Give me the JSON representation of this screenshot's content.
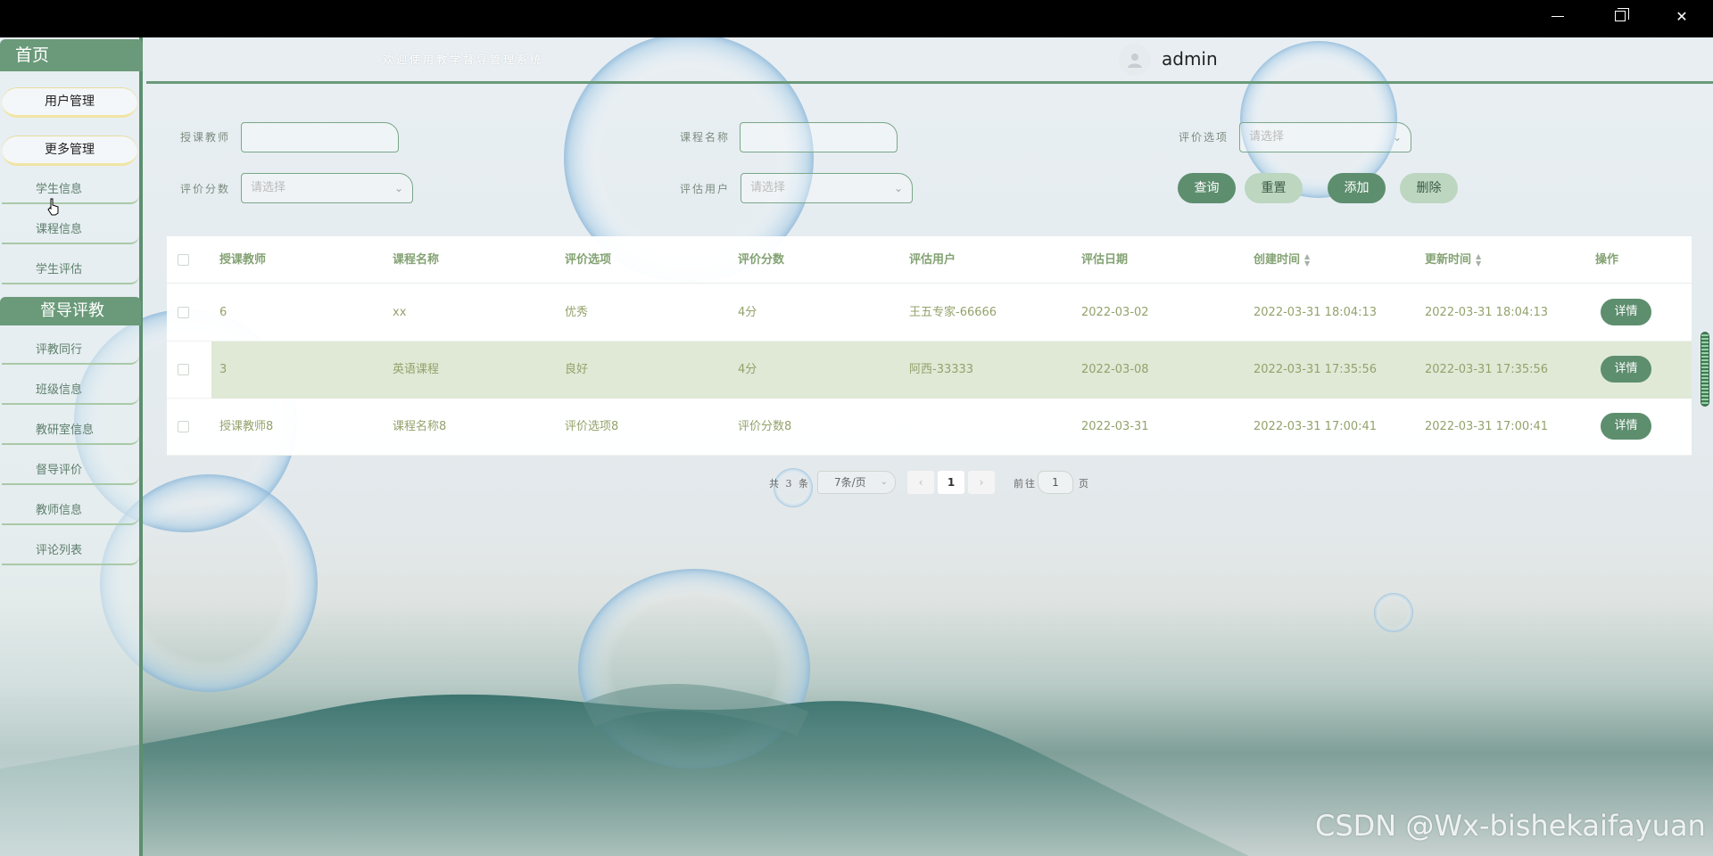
{
  "window_controls": {
    "minimize": "—",
    "maximize": "❐",
    "close": "✕"
  },
  "header": {
    "welcome": "欢迎使用教学督导管理系统",
    "username": "admin"
  },
  "sidebar": {
    "home": "首页",
    "pills": [
      "用户管理",
      "更多管理"
    ],
    "group1": [
      "学生信息",
      "课程信息",
      "学生评估"
    ],
    "section": "督导评教",
    "group2": [
      "评教同行",
      "班级信息",
      "教研室信息",
      "督导评价",
      "教师信息",
      "评论列表"
    ]
  },
  "search": {
    "teacher_label": "授课教师",
    "teacher_value": "",
    "course_label": "课程名称",
    "course_value": "",
    "option_label": "评价选项",
    "option_placeholder": "请选择",
    "score_label": "评价分数",
    "score_placeholder": "请选择",
    "user_label": "评估用户",
    "user_placeholder": "请选择",
    "query_btn": "查询",
    "reset_btn": "重置",
    "add_btn": "添加",
    "delete_btn": "删除"
  },
  "table": {
    "columns": [
      "授课教师",
      "课程名称",
      "评价选项",
      "评价分数",
      "评估用户",
      "评估日期",
      "创建时间",
      "更新时间",
      "操作"
    ],
    "rows": [
      {
        "teacher": "6",
        "course": "xx",
        "option": "优秀",
        "score": "4分",
        "user": "王五专家-66666",
        "date": "2022-03-02",
        "created": "2022-03-31 18:04:13",
        "updated": "2022-03-31 18:04:13",
        "action": "详情"
      },
      {
        "teacher": "3",
        "course": "英语课程",
        "option": "良好",
        "score": "4分",
        "user": "阿西-33333",
        "date": "2022-03-08",
        "created": "2022-03-31 17:35:56",
        "updated": "2022-03-31 17:35:56",
        "action": "详情"
      },
      {
        "teacher": "授课教师8",
        "course": "课程名称8",
        "option": "评价选项8",
        "score": "评价分数8",
        "user": "",
        "date": "2022-03-31",
        "created": "2022-03-31 17:00:41",
        "updated": "2022-03-31 17:00:41",
        "action": "详情"
      }
    ]
  },
  "pagination": {
    "total": "共 3 条",
    "page_size": "7条/页",
    "prev": "‹",
    "current": "1",
    "next": "›",
    "goto_label": "前往",
    "goto_value": "1",
    "page_suffix": "页"
  },
  "watermark": "CSDN @Wx-bishekaifayuan",
  "colors": {
    "accent": "#5d8e6e",
    "accent_light": "#bcd6c0",
    "text_cell": "#93a26b",
    "row_highlight": "#dfe9d6"
  }
}
